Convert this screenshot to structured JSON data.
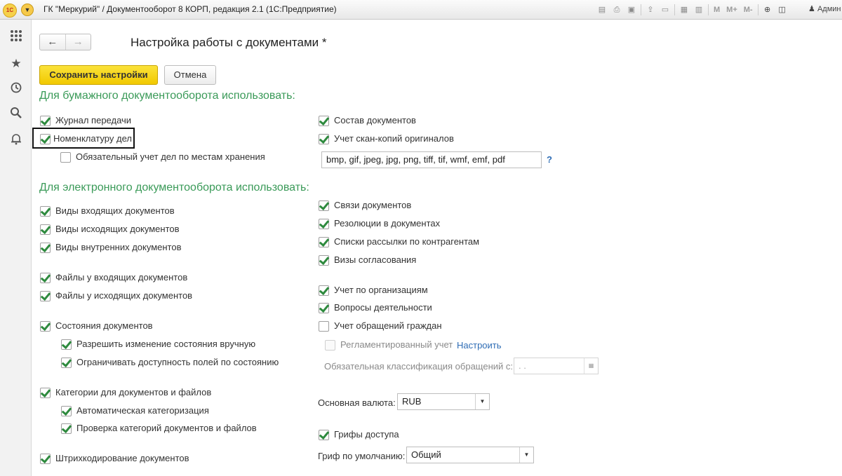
{
  "window": {
    "logo": "1С",
    "title": "ГК \"Меркурий\" / Документооборот 8 КОРП, редакция 2.1  (1С:Предприятие)",
    "user": "Админ",
    "toolbar_text": [
      "M",
      "M+",
      "M-"
    ]
  },
  "leftbar": {
    "icons": [
      "apps-grid-icon",
      "star-icon",
      "history-icon",
      "search-icon",
      "bell-icon"
    ]
  },
  "form": {
    "back": "←",
    "forward": "→",
    "title": "Настройка работы с документами *",
    "save_label": "Сохранить настройки",
    "cancel_label": "Отмена"
  },
  "paper": {
    "section_title": "Для бумажного документооборота использовать:",
    "journal": {
      "label": "Журнал передачи",
      "checked": true
    },
    "nomenclature": {
      "label": "Номенклатуру дел",
      "checked": true
    },
    "storage": {
      "label": "Обязательный учет дел по местам хранения",
      "checked": false
    },
    "composition": {
      "label": "Состав документов",
      "checked": true
    },
    "scans": {
      "label": "Учет скан-копий оригиналов",
      "checked": true
    },
    "extensions": "bmp, gif, jpeg, jpg, png, tiff, tif, wmf, emf, pdf",
    "help": "?"
  },
  "electronic": {
    "section_title": "Для электронного документооборота использовать:",
    "left": [
      {
        "label": "Виды входящих документов",
        "checked": true
      },
      {
        "label": "Виды исходящих документов",
        "checked": true
      },
      {
        "label": "Виды внутренних документов",
        "checked": true
      },
      {
        "label": "Файлы у входящих документов",
        "checked": true
      },
      {
        "label": "Файлы у исходящих документов",
        "checked": true
      },
      {
        "label": "Состояния документов",
        "checked": true
      },
      {
        "label": "Разрешить изменение состояния вручную",
        "checked": true
      },
      {
        "label": "Ограничивать доступность полей по состоянию",
        "checked": true
      },
      {
        "label": "Категории для документов и файлов",
        "checked": true
      },
      {
        "label": "Автоматическая категоризация",
        "checked": true
      },
      {
        "label": "Проверка категорий документов и файлов",
        "checked": true
      },
      {
        "label": "Штрихкодирование документов",
        "checked": true
      }
    ],
    "right": [
      {
        "label": "Связи документов",
        "checked": true
      },
      {
        "label": "Резолюции в документах",
        "checked": true
      },
      {
        "label": "Списки рассылки по контрагентам",
        "checked": true
      },
      {
        "label": "Визы согласования",
        "checked": true
      },
      {
        "label": "Учет по организациям",
        "checked": true
      },
      {
        "label": "Вопросы деятельности",
        "checked": true
      },
      {
        "label": "Учет обращений граждан",
        "checked": false
      },
      {
        "label": "Регламентированный учет",
        "checked": false
      },
      {
        "label": "Грифы доступа",
        "checked": true
      }
    ],
    "configure_link": "Настроить",
    "classification_label": "Обязательная классификация обращений с:",
    "classification_value": " .  .",
    "currency_label": "Основная валюта:",
    "currency_value": "RUB",
    "grif_label": "Гриф по умолчанию:",
    "grif_value": "Общий"
  }
}
